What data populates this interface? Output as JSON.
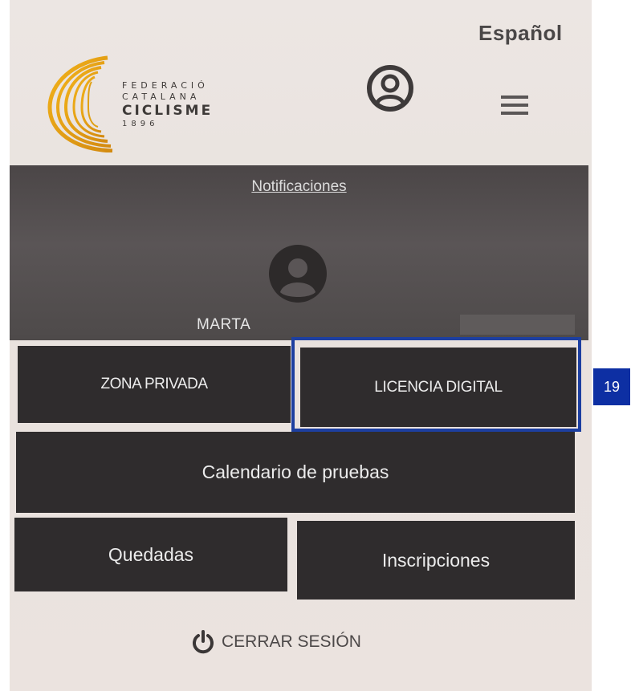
{
  "header": {
    "language": "Español",
    "logo": {
      "line1": "FEDERACIÓ",
      "line2": "CATALANA",
      "line3": "CICLISME",
      "line4": "1896"
    },
    "user_icon": "user-circle-icon",
    "menu_icon": "hamburger-menu-icon"
  },
  "profile": {
    "notifications_label": "Notificaciones",
    "avatar_icon": "user-circle-icon",
    "name": "MARTA"
  },
  "menu": {
    "private_zone": "ZONA PRIVADA",
    "digital_license": "LICENCIA DIGITAL",
    "calendar": "Calendario de pruebas",
    "meetups": "Quedadas",
    "registrations": "Inscripciones"
  },
  "footer": {
    "logout_label": "CERRAR SESIÓN",
    "logout_icon": "power-icon"
  },
  "annotation": {
    "badge_number": "19",
    "highlight_color": "#1d3fa0"
  }
}
